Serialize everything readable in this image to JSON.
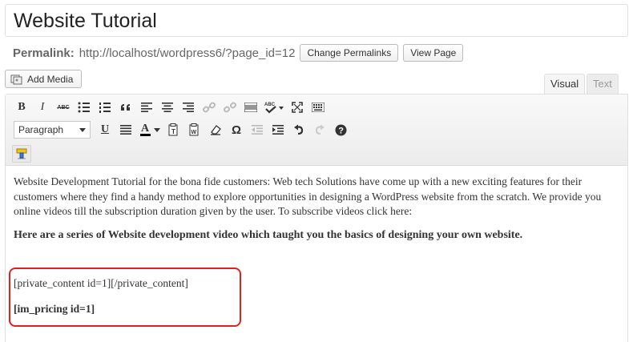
{
  "post": {
    "title": "Website Tutorial",
    "permalink_label": "Permalink:",
    "permalink_url": "http://localhost/wordpress6/?page_id=12",
    "change_permalinks": "Change Permalinks",
    "view_page": "View Page"
  },
  "media": {
    "add_media": "Add Media"
  },
  "tabs": {
    "visual": "Visual",
    "text": "Text"
  },
  "toolbar": {
    "bold": "B",
    "italic": "I",
    "strike": "ABC",
    "format_value": "Paragraph",
    "underline": "U",
    "text_color": "A",
    "omega": "Ω",
    "help": "?"
  },
  "content": {
    "para1": "Website Development Tutorial for the bona fide customers: Web tech Solutions have come up with a new exciting features for their customers where they find a handy method to explore opportunities in designing a WordPress website from the scratch. We provide you online videos till the subscription duration given by the user. To subscribe videos click here:",
    "heading": "Here are a series of Website development video which taught you the basics of designing your own website.",
    "shortcode1": "[private_content id=1][/private_content]",
    "shortcode2": "[im_pricing id=1]"
  },
  "colors": {
    "highlight_border": "#e0201f",
    "text_color_bar": "#000000"
  }
}
